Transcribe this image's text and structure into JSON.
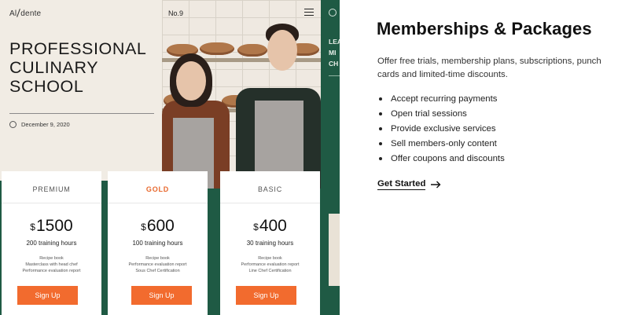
{
  "mockup": {
    "logo": {
      "left": "Al",
      "right": "dente"
    },
    "hero_title": "PROFESSIONAL CULINARY SCHOOL",
    "hero_date": "December 9, 2020",
    "photo_tag": "No.9",
    "strip_text": [
      "LEA",
      "MI",
      "CH"
    ],
    "cards": [
      {
        "tier": "PREMIUM",
        "currency": "$",
        "price": "1500",
        "hours": "200 training hours",
        "features": [
          "Recipe book",
          "Masterclass with head chef",
          "Performance evaluation report"
        ],
        "button": "Sign Up"
      },
      {
        "tier": "GOLD",
        "currency": "$",
        "price": "600",
        "hours": "100 training hours",
        "features": [
          "Recipe book",
          "Performance evaluation report",
          "Sous Chef Certification"
        ],
        "button": "Sign Up"
      },
      {
        "tier": "BASIC",
        "currency": "$",
        "price": "400",
        "hours": "30 training hours",
        "features": [
          "Recipe book",
          "Performance evaluation report",
          "Line Chef Certification"
        ],
        "button": "Sign Up"
      }
    ],
    "colors": {
      "brand_green": "#1f5a44",
      "accent_orange": "#f26b2e",
      "hero_bg": "#f1ece4"
    }
  },
  "content": {
    "title": "Memberships & Packages",
    "description": "Offer free trials, membership plans, subscriptions, punch cards and limited-time discounts.",
    "bullets": [
      "Accept recurring payments",
      "Open trial sessions",
      "Provide exclusive services",
      "Sell members-only content",
      "Offer coupons and discounts"
    ],
    "cta_label": "Get Started",
    "cta_icon": "arrow-right-icon"
  }
}
